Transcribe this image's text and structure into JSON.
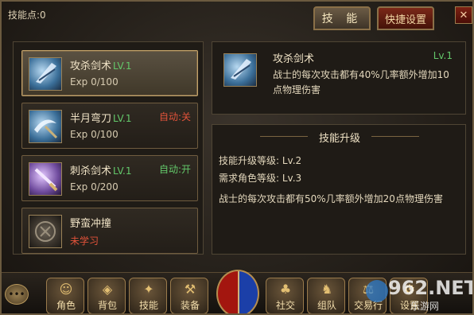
{
  "header": {
    "skill_points_label": "技能点:0"
  },
  "tabs": [
    {
      "label": "技 能"
    },
    {
      "label": "快捷设置"
    }
  ],
  "close_icon": "✕",
  "skills": [
    {
      "name": "攻杀剑术",
      "level": "LV.1",
      "exp": "Exp 0/100",
      "auto": "",
      "icon": "axe-blade-icon",
      "selected": true
    },
    {
      "name": "半月弯刀",
      "level": "LV.1",
      "exp": "Exp 0/100",
      "auto": "自动:关",
      "icon": "crescent-blade-icon"
    },
    {
      "name": "刺杀剑术",
      "level": "LV.1",
      "exp": "Exp 0/200",
      "auto": "自动:开",
      "icon": "thrust-sword-icon"
    },
    {
      "name": "野蛮冲撞",
      "level": "",
      "exp": "",
      "status": "未学习",
      "icon": "charge-rune-icon"
    }
  ],
  "detail": {
    "name": "攻杀剑术",
    "level": "Lv.1",
    "description": "战士的每次攻击都有40%几率额外增加10点物理伤害"
  },
  "upgrade": {
    "title": "技能升级",
    "skill_level_req": "技能升级等级: Lv.2",
    "char_level_req": "需求角色等级: Lv.3",
    "description": "战士的每次攻击都有50%几率额外增加20点物理伤害"
  },
  "bottom": {
    "chat_label": "•••",
    "buttons": [
      {
        "label": "角色",
        "icon": "character-icon"
      },
      {
        "label": "背包",
        "icon": "bag-icon"
      },
      {
        "label": "技能",
        "icon": "skills-icon"
      },
      {
        "label": "装备",
        "icon": "equipment-icon"
      },
      {
        "label": "社交",
        "icon": "social-icon"
      },
      {
        "label": "组队",
        "icon": "team-icon"
      },
      {
        "label": "交易行",
        "icon": "trade-icon"
      },
      {
        "label": "设置",
        "icon": "settings-icon"
      }
    ]
  },
  "watermark": {
    "big": "962.NET",
    "small": "乐游网"
  },
  "colors": {
    "level_green": "#63c86a",
    "auto_off_red": "#e2533a",
    "gold_border": "#9a7b4c"
  }
}
